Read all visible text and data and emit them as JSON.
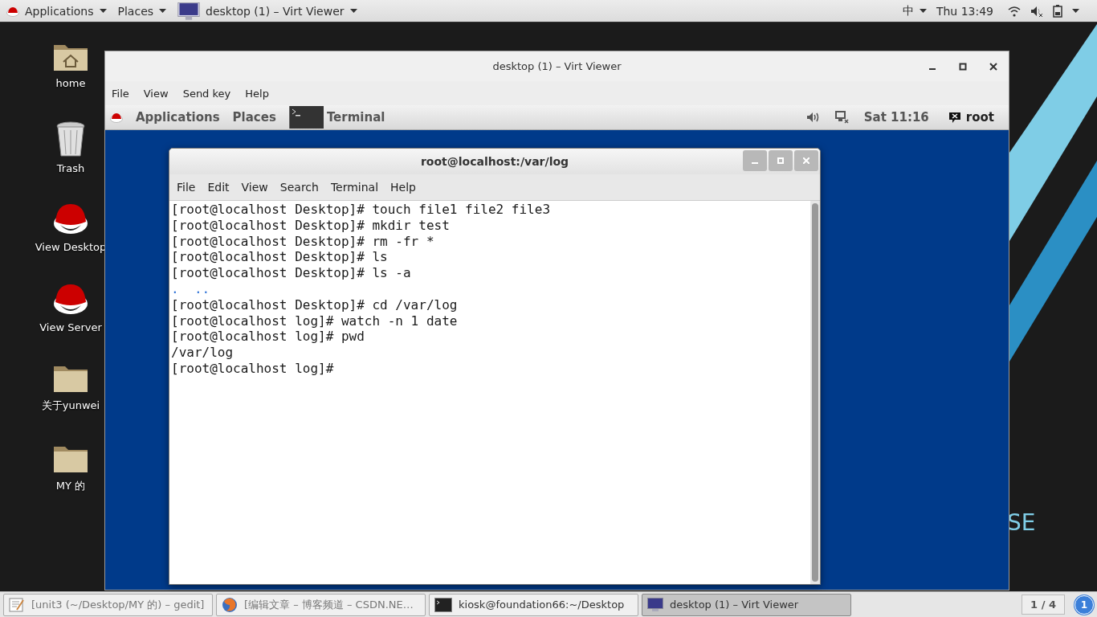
{
  "top_bar": {
    "menus": [
      {
        "label": "Applications"
      },
      {
        "label": "Places"
      }
    ],
    "active_window": "desktop (1) – Virt Viewer",
    "input_method": "中",
    "clock": "Thu 13:49"
  },
  "desktop_icons": [
    {
      "label": "home",
      "kind": "home"
    },
    {
      "label": "Trash",
      "kind": "trash"
    },
    {
      "label": "View Desktop",
      "kind": "redhat"
    },
    {
      "label": "View Server",
      "kind": "redhat"
    },
    {
      "label": "关于yunwei",
      "kind": "folder"
    },
    {
      "label": "MY 的",
      "kind": "folder"
    }
  ],
  "wallpaper_text": "SE",
  "viewer_window": {
    "title": "desktop (1) – Virt Viewer",
    "menu": [
      "File",
      "View",
      "Send key",
      "Help"
    ],
    "guest_panel": {
      "menus": [
        "Applications",
        "Places"
      ],
      "task": "Terminal",
      "clock": "Sat 11:16",
      "user": "root"
    },
    "terminal": {
      "title": "root@localhost:/var/log",
      "menu": [
        "File",
        "Edit",
        "View",
        "Search",
        "Terminal",
        "Help"
      ],
      "lines": [
        {
          "text": "[root@localhost Desktop]# touch file1 file2 file3",
          "kind": "command"
        },
        {
          "text": "[root@localhost Desktop]# mkdir test",
          "kind": "command"
        },
        {
          "text": "[root@localhost Desktop]# rm -fr *",
          "kind": "command"
        },
        {
          "text": "[root@localhost Desktop]# ls",
          "kind": "command"
        },
        {
          "text": "[root@localhost Desktop]# ls -a",
          "kind": "command"
        },
        {
          "text": ".  ..",
          "kind": "directory"
        },
        {
          "text": "[root@localhost Desktop]# cd /var/log",
          "kind": "command"
        },
        {
          "text": "[root@localhost log]# watch -n 1 date",
          "kind": "command"
        },
        {
          "text": "[root@localhost log]# pwd",
          "kind": "command"
        },
        {
          "text": "/var/log",
          "kind": "output"
        },
        {
          "text": "[root@localhost log]#",
          "kind": "command"
        }
      ]
    }
  },
  "taskbar": {
    "tasks": [
      {
        "label": "[unit3 (~/Desktop/MY 的) – gedit]",
        "kind": "editor",
        "selected": false
      },
      {
        "label": "[编辑文章 – 博客频道 – CSDN.NE…",
        "kind": "browser",
        "selected": false
      },
      {
        "label": "kiosk@foundation66:~/Desktop",
        "kind": "terminal",
        "selected": false
      },
      {
        "label": "desktop (1) – Virt Viewer",
        "kind": "viewer",
        "selected": true
      }
    ],
    "workspace": "1 / 4",
    "notification_count": "1"
  }
}
